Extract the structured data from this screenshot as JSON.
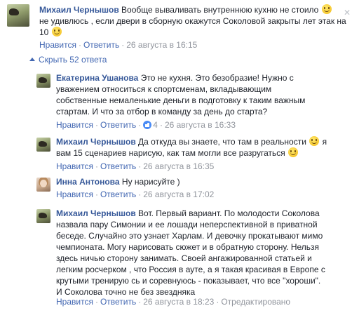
{
  "ui": {
    "like_label": "Нравится",
    "reply_label": "Ответить",
    "sep": "·",
    "hide_replies": "Скрыть 52 ответа"
  },
  "comments": [
    {
      "author": "Михаил Чернышов",
      "text1": "Вообще вываливать внутреннюю кухню не стоило",
      "text2": "не удивлюсь , если двери в сборную окажутся Соколовой закрыты лет этак на 10",
      "date": "26 августа в 16:15"
    },
    {
      "author": "Екатерина Ушанова",
      "text": "Это не кухня. Это безобразие! Нужно с уважением относиться к спортсменам, вкладывающим собственные немаленькие деньги в подготовку к таким важным стартам. И что за отбор в команду за день до старта?",
      "likes": "4",
      "date": "26 августа в 16:33"
    },
    {
      "author": "Михаил Чернышов",
      "text1": "Да откуда вы знаете, что там в реальности",
      "text2": "я вам 15 сценариев нарисую, как там могли все разругаться",
      "date": "26 августа в 16:35"
    },
    {
      "author": "Инна Антонова",
      "text": "Ну нарисуйте )",
      "date": "26 августа в 17:02"
    },
    {
      "author": "Михаил Чернышов",
      "text": "Вот. Первый вариант. По молодости Соколова назвала пару Симонии и ее лошади неперспективной в приватной беседе. Случайно это узнает Харлам. И девочку прокатывают мимо чемпионата. Могу нарисовать сюжет и в обратную сторону. Нельзя здесь ничью сторону занимать. Своей ангажированной статьей и легким росчерком , что Россия в ауте, а я такая красивая в Европе с крутыми тренирую сь и соревнуюсь - показывает, что все \"хороши\". И Соколова точно не без звездняка",
      "date": "26 августа в 18:23",
      "edited": "Отредактировано"
    }
  ]
}
